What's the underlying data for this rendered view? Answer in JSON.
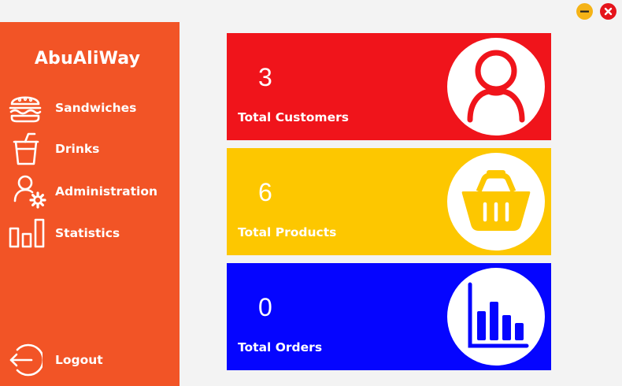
{
  "window": {
    "minimize_icon": "minimize-icon",
    "close_icon": "close-icon"
  },
  "sidebar": {
    "title": "AbuAliWay",
    "items": [
      {
        "label": "Sandwiches",
        "icon": "burger-icon"
      },
      {
        "label": "Drinks",
        "icon": "drink-cup-icon"
      },
      {
        "label": "Administration",
        "icon": "user-settings-icon"
      },
      {
        "label": "Statistics",
        "icon": "bar-chart-icon"
      }
    ],
    "logout": {
      "label": "Logout",
      "icon": "logout-icon"
    }
  },
  "cards": [
    {
      "value": "3",
      "label": "Total Customers",
      "icon": "user-icon",
      "color": "#f0141b"
    },
    {
      "value": "6",
      "label": "Total Products",
      "icon": "basket-icon",
      "color": "#fdc700"
    },
    {
      "value": "0",
      "label": "Total Orders",
      "icon": "bar-chart-icon",
      "color": "#0505ff"
    }
  ],
  "colors": {
    "sidebar": "#f25426",
    "background": "#f3f3f3",
    "minimize": "#f5b316",
    "close": "#e5141b"
  }
}
